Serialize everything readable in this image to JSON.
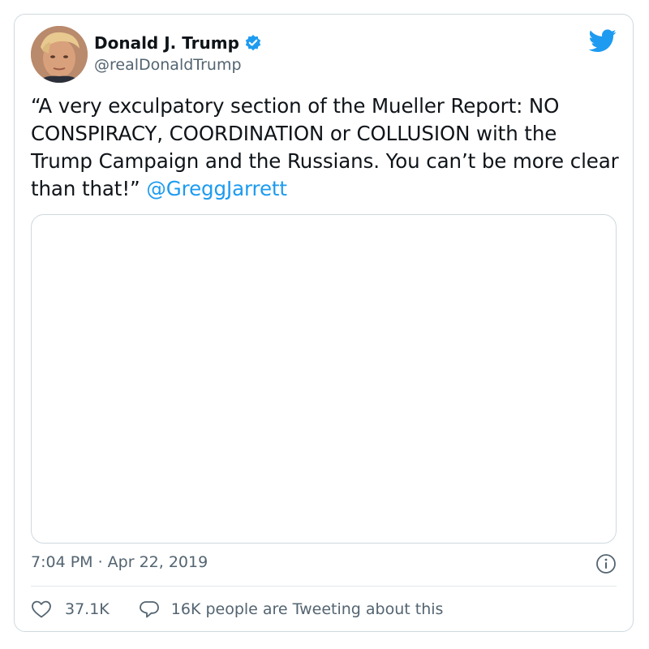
{
  "tweet": {
    "author": {
      "display_name": "Donald J. Trump",
      "handle": "@realDonaldTrump",
      "verified": true
    },
    "text": "“A very exculpatory section of the Mueller Report: NO CONSPIRACY, COORDINATION or COLLUSION with the Trump Campaign and the Russians. You can’t be more clear than that!”",
    "mention": "@GreggJarrett",
    "timestamp": "7:04 PM · Apr 22, 2019",
    "likes": "37.1K",
    "tweeting_about": "16K people are Tweeting about this"
  },
  "icons": {
    "brand": "twitter-bird-icon",
    "verified": "verified-badge-icon",
    "info": "info-icon",
    "like": "heart-icon",
    "reply": "speech-bubble-icon"
  },
  "colors": {
    "accent": "#1d9bf0",
    "text": "#0f1419",
    "secondary_text": "#536471",
    "border": "#cfd9de"
  }
}
